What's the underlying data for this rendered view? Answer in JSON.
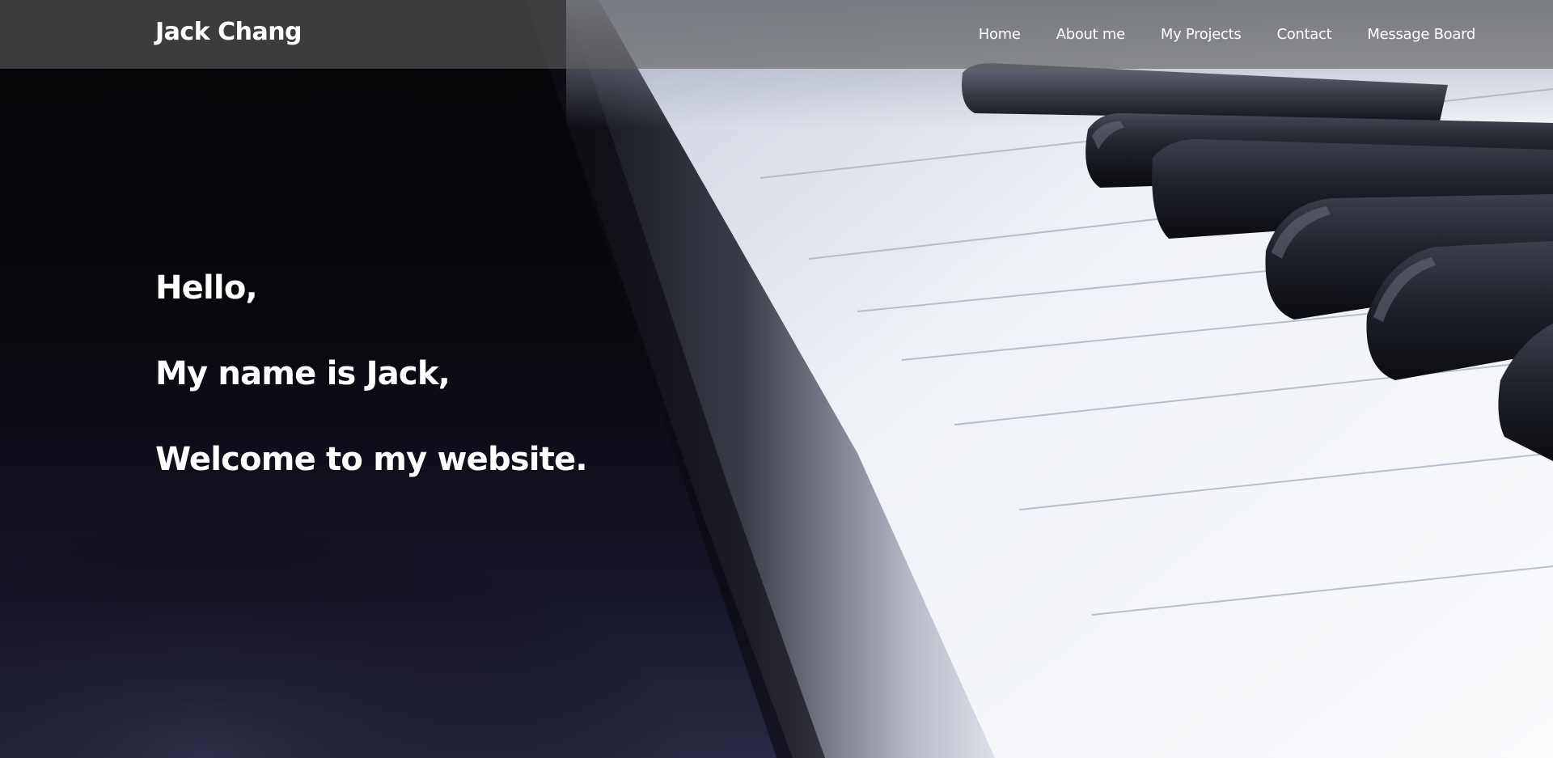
{
  "navbar": {
    "brand": "Jack Chang",
    "links": [
      {
        "label": "Home"
      },
      {
        "label": "About me"
      },
      {
        "label": "My Projects"
      },
      {
        "label": "Contact"
      },
      {
        "label": "Message Board"
      }
    ]
  },
  "hero": {
    "lines": [
      "Hello,",
      "My name is Jack,",
      "Welcome to my website."
    ]
  },
  "colors": {
    "background": "#000000",
    "text": "#ffffff",
    "navbar_overlay": "#5f5f5f",
    "black_key": "#1c1e26",
    "white_key": "#e8ebf2"
  }
}
